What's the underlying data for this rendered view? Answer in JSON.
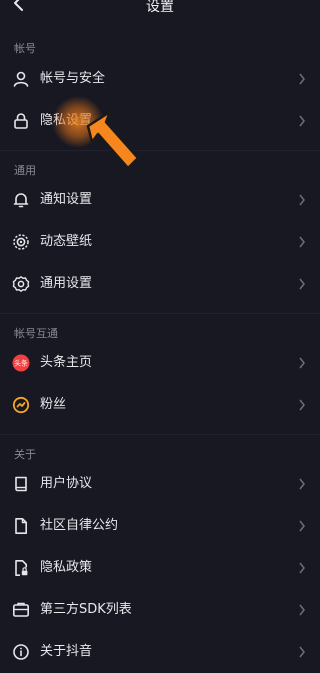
{
  "header": {
    "title": "设置"
  },
  "sections": {
    "account": "帐号",
    "general": "通用",
    "interop": "帐号互通",
    "about": "关于"
  },
  "items": [
    {
      "label": "帐号与安全",
      "icon": "person-icon"
    },
    {
      "label": "隐私设置",
      "icon": "lock-icon"
    },
    {
      "label": "通知设置",
      "icon": "bell-icon"
    },
    {
      "label": "动态壁纸",
      "icon": "wallpaper-icon"
    },
    {
      "label": "通用设置",
      "icon": "gear-icon"
    },
    {
      "label": "头条主页",
      "icon": "toutiao-icon",
      "badge": "头条"
    },
    {
      "label": "粉丝",
      "icon": "fans-icon"
    },
    {
      "label": "用户协议",
      "icon": "book-icon"
    },
    {
      "label": "社区自律公约",
      "icon": "document-icon"
    },
    {
      "label": "隐私政策",
      "icon": "privacy-doc-icon"
    },
    {
      "label": "第三方SDK列表",
      "icon": "sdk-list-icon"
    },
    {
      "label": "关于抖音",
      "icon": "info-icon"
    }
  ],
  "colors": {
    "background": "#181822",
    "text": "#e8e8ec",
    "section": "#8a8a94",
    "chevron": "#6e6e78",
    "toutiao_red": "#f04142",
    "fans_orange": "#f5a623",
    "pointer_orange": "#f6871f"
  }
}
